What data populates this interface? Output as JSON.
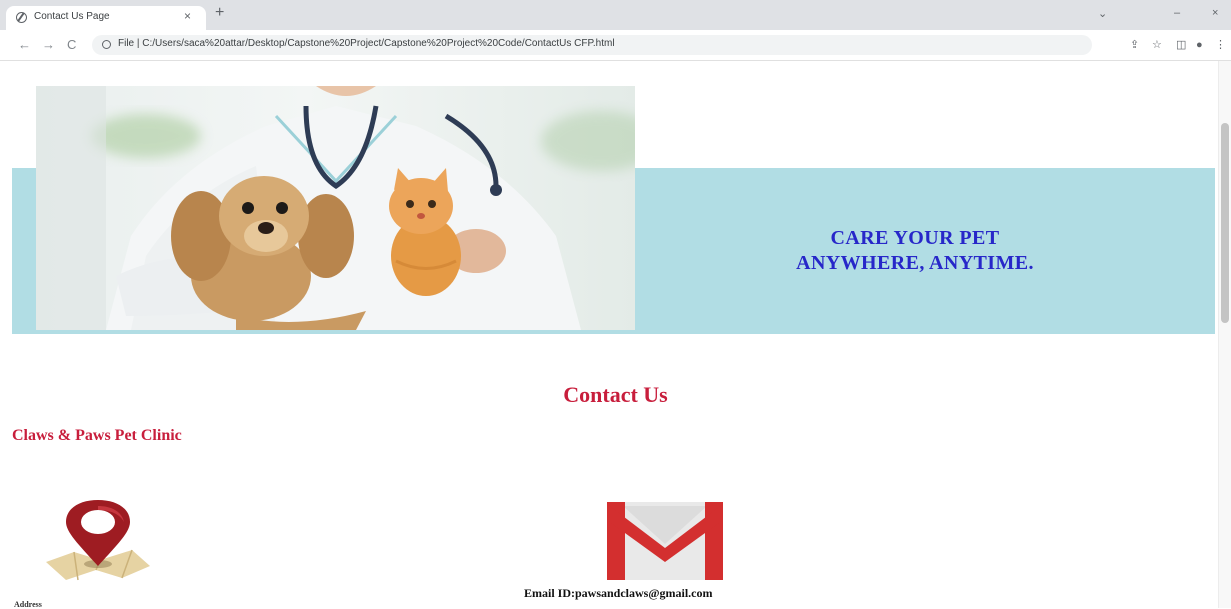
{
  "browser": {
    "tab_title": "Contact Us Page",
    "tab_close": "×",
    "new_tab": "+",
    "url": "File | C:/Users/saca%20attar/Desktop/Capstone%20Project/Capstone%20Project%20Code/ContactUs CFP.html",
    "controls": {
      "back": "←",
      "forward": "→",
      "reload": "C"
    },
    "window": {
      "dropdown": "⌄",
      "minimize": "‒",
      "close": "×"
    }
  },
  "banner": {
    "tagline_line1": "CARE YOUR PET",
    "tagline_line2": "ANYWHERE, ANYTIME."
  },
  "contact": {
    "heading": "Contact Us",
    "clinic_name": "Claws & Paws Pet Clinic",
    "address_label": "Address",
    "email_text": "Email ID:pawsandclaws@gmail.com"
  },
  "colors": {
    "banner_bg": "#b1dde4",
    "tagline": "#2727c9",
    "heading": "#c81e3c"
  }
}
